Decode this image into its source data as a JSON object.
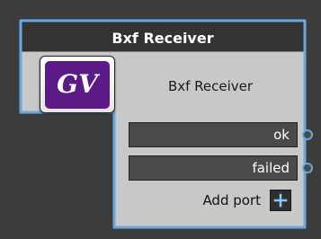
{
  "node": {
    "header_title": "Bxf Receiver",
    "title": "Bxf Receiver",
    "logo": {
      "icon": "gv-logo-icon",
      "text": "GV",
      "colors": {
        "background": "#5b1a86",
        "foreground": "#ffffff",
        "button_background": "#ffffff"
      }
    },
    "ports": [
      {
        "label": "ok"
      },
      {
        "label": "failed"
      }
    ],
    "add_port": {
      "label": "Add port",
      "icon": "plus-icon"
    },
    "colors": {
      "canvas_background": "#3c3c3c",
      "node_body": "#c8c8c8",
      "header_background": "#333333",
      "border": "#68a7df",
      "port_background": "#4a4a4a"
    }
  }
}
